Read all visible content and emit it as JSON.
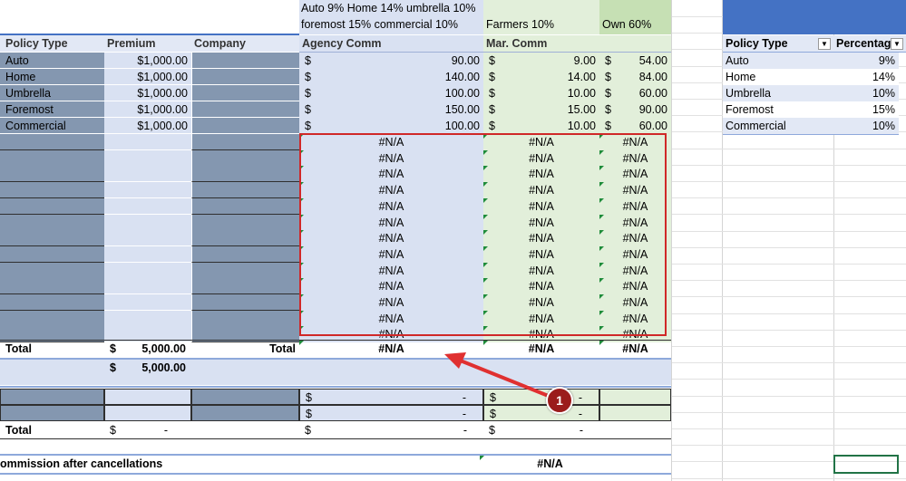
{
  "top_notes": {
    "agency_note_line1": "Auto 9% Home 14% umbrella 10%",
    "agency_note_line2": "foremost 15% commercial 10%",
    "farmers_note": "Farmers 10%",
    "own_note": "Own 60%"
  },
  "headers": {
    "policy_type": "Policy Type",
    "premium": "Premium",
    "company": "Company",
    "agency_comm": "Agency Comm",
    "mar_comm": "Mar. Comm"
  },
  "rows": [
    {
      "policy": "Auto",
      "premium": "$1,000.00",
      "agency": "90.00",
      "mar": "9.00",
      "own": "54.00"
    },
    {
      "policy": "Home",
      "premium": "$1,000.00",
      "agency": "140.00",
      "mar": "14.00",
      "own": "84.00"
    },
    {
      "policy": "Umbrella",
      "premium": "$1,000.00",
      "agency": "100.00",
      "mar": "10.00",
      "own": "60.00"
    },
    {
      "policy": "Foremost",
      "premium": "$1,000.00",
      "agency": "150.00",
      "mar": "15.00",
      "own": "90.00"
    },
    {
      "policy": "Commercial",
      "premium": "$1,000.00",
      "agency": "100.00",
      "mar": "10.00",
      "own": "60.00"
    }
  ],
  "currency_symbol": "$",
  "na_value": "#N/A",
  "na_row_count": 13,
  "totals": {
    "label": "Total",
    "premium_symbol": "$",
    "premium_value": "5,000.00",
    "company_label": "Total",
    "agency": "#N/A",
    "mar": "#N/A",
    "own": "#N/A"
  },
  "subtotal": {
    "symbol": "$",
    "value": "5,000.00"
  },
  "cancel_rows": [
    {
      "agency_symbol": "$",
      "agency_value": "-",
      "mar_symbol": "$",
      "mar_value": "-"
    },
    {
      "agency_symbol": "$",
      "agency_value": "-",
      "mar_symbol": "$",
      "mar_value": "-"
    }
  ],
  "cancel_total": {
    "label": "Total",
    "premium_symbol": "$",
    "premium_value": "-",
    "agency_symbol": "$",
    "agency_value": "-",
    "mar_symbol": "$",
    "mar_value": "-"
  },
  "after_cancel": {
    "label": "ommission after cancellations",
    "value": "#N/A"
  },
  "lookup_table": {
    "header_policy": "Policy Type",
    "header_percentage": "Percentag",
    "rows": [
      {
        "policy": "Auto",
        "pct": "9%"
      },
      {
        "policy": "Home",
        "pct": "14%"
      },
      {
        "policy": "Umbrella",
        "pct": "10%"
      },
      {
        "policy": "Foremost",
        "pct": "15%"
      },
      {
        "policy": "Commercial",
        "pct": "10%"
      }
    ]
  },
  "callout": {
    "number": "1"
  },
  "colors": {
    "highlight_box": "#d02828",
    "arrow": "#e03030",
    "callout_circle": "#9b1c1c",
    "header_blue": "#4472c4"
  }
}
